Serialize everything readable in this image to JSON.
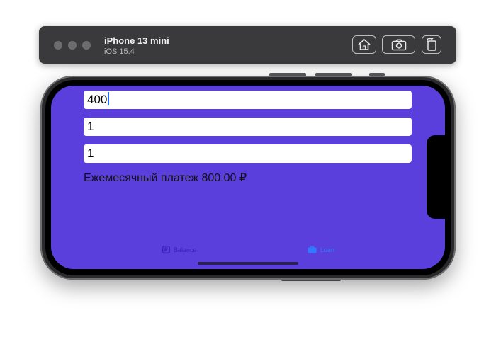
{
  "simulator": {
    "device_name": "iPhone 13 mini",
    "os_version": "iOS 15.4"
  },
  "app": {
    "fields": {
      "amount_value": "400",
      "term_value": "1",
      "rate_value": "1"
    },
    "monthly_payment_text": "Ежемесячный платеж 800.00 ₽",
    "tabs": {
      "balance_label": "Balance",
      "loan_label": "Loan"
    },
    "colors": {
      "background": "#5b3fdd",
      "active_tab": "#2f7bff",
      "inactive_tab": "#3a1fbf"
    }
  }
}
